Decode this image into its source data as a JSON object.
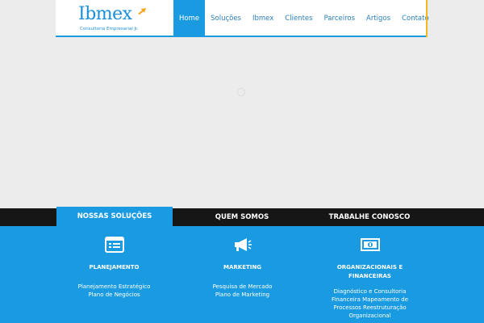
{
  "header": {
    "logo": {
      "word": "Ibmex",
      "subtitle": "Consultoria Empresarial Jr.",
      "arrow_color": "#f3a51d"
    },
    "nav": [
      {
        "label": "Home",
        "active": true
      },
      {
        "label": "Soluções",
        "active": false
      },
      {
        "label": "Ibmex",
        "active": false
      },
      {
        "label": "Clientes",
        "active": false
      },
      {
        "label": "Parceiros",
        "active": false
      },
      {
        "label": "Artigos",
        "active": false
      },
      {
        "label": "Contato",
        "active": false
      }
    ]
  },
  "tabs": [
    {
      "label": "NOSSAS SOLUÇÕES",
      "active": true
    },
    {
      "label": "QUEM SOMOS",
      "active": false
    },
    {
      "label": "TRABALHE CONOSCO",
      "active": false
    }
  ],
  "solutions": [
    {
      "icon": "calendar-icon",
      "title": "PLANEJAMENTO",
      "lines": [
        "Planejamento Estratégico",
        "Plano de Negócios"
      ]
    },
    {
      "icon": "megaphone-icon",
      "title": "MARKETING",
      "lines": [
        "Pesquisa de Mercado",
        "Plano de Marketing"
      ]
    },
    {
      "icon": "money-icon",
      "title_lines": [
        "ORGANIZACIONAIS E",
        "FINANCEIRAS"
      ],
      "lines": [
        "Diagnóstico e Consultoria",
        "Financeira Mapeamento de",
        "Processos Reestruturação",
        "Organizacional"
      ]
    }
  ],
  "colors": {
    "brand_blue": "#1a9ae0",
    "dark_bar": "#161616",
    "accent_yellow": "#f3b81d",
    "page_bg": "#ececec"
  }
}
